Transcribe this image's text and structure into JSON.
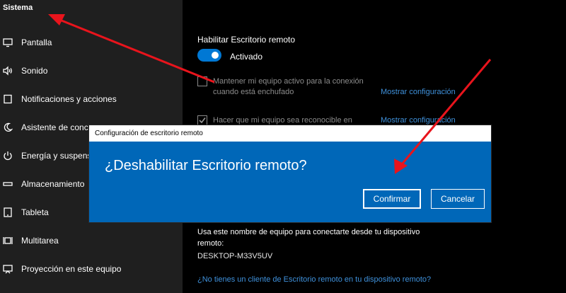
{
  "sidebar": {
    "title": "Sistema",
    "items": [
      {
        "label": "Pantalla",
        "icon": "monitor-icon"
      },
      {
        "label": "Sonido",
        "icon": "speaker-icon"
      },
      {
        "label": "Notificaciones y acciones",
        "icon": "notification-icon"
      },
      {
        "label": "Asistente de conce",
        "icon": "moon-icon"
      },
      {
        "label": "Energía y suspensió",
        "icon": "power-icon"
      },
      {
        "label": "Almacenamiento",
        "icon": "storage-icon"
      },
      {
        "label": "Tableta",
        "icon": "tablet-icon"
      },
      {
        "label": "Multitarea",
        "icon": "multitask-icon"
      },
      {
        "label": "Proyección en este equipo",
        "icon": "projection-icon"
      }
    ]
  },
  "main": {
    "section_title": "Habilitar Escritorio remoto",
    "toggle_state": "on",
    "toggle_label": "Activado",
    "option1_line1": "Mantener mi equipo activo para la conexión",
    "option1_line2": "cuando está enchufado",
    "option1_checked": false,
    "option1_link": "Mostrar configuración",
    "option2_line1": "Hacer que mi equipo sea reconocible en",
    "option2_checked": true,
    "option2_link": "Mostrar configuración",
    "info_line1": "Usa este nombre de equipo para conectarte desde tu dispositivo",
    "info_line2": "remoto:",
    "pc_name": "DESKTOP-M33V5UV",
    "bottom_link": "¿No tienes un cliente de Escritorio remoto en tu dispositivo remoto?"
  },
  "dialog": {
    "title": "Configuración de escritorio remoto",
    "question": "¿Deshabilitar Escritorio remoto?",
    "confirm_label": "Confirmar",
    "cancel_label": "Cancelar"
  },
  "colors": {
    "accent": "#0078d4",
    "dialog_bg": "#0067b8",
    "link": "#3f91db",
    "annotation_arrow": "#e8141c",
    "sidebar_bg": "#1f1f1f"
  }
}
